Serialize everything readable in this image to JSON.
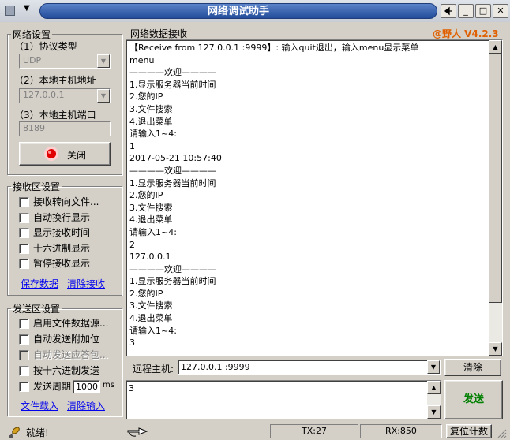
{
  "window": {
    "title": "网络调试助手",
    "version": "@野人 V4.2.3"
  },
  "titlebar": {
    "pin_icon": "pin-icon",
    "minimize": "_",
    "maximize": "□",
    "close": "✕"
  },
  "network": {
    "legend": "网络设置",
    "protocol_label": "（1）协议类型",
    "protocol_value": "UDP",
    "host_label": "（2）本地主机地址",
    "host_value": "127.0.0.1",
    "port_label": "（3）本地主机端口",
    "port_value": "8189",
    "close_button": "关闭"
  },
  "recv_settings": {
    "legend": "接收区设置",
    "options": [
      {
        "label": "接收转向文件...",
        "checked": false,
        "disabled": false
      },
      {
        "label": "自动换行显示",
        "checked": false,
        "disabled": false
      },
      {
        "label": "显示接收时间",
        "checked": false,
        "disabled": false
      },
      {
        "label": "十六进制显示",
        "checked": false,
        "disabled": false
      },
      {
        "label": "暂停接收显示",
        "checked": false,
        "disabled": false
      }
    ],
    "save_link": "保存数据",
    "clear_link": "清除接收"
  },
  "send_settings": {
    "legend": "发送区设置",
    "options": [
      {
        "label": "启用文件数据源...",
        "checked": false,
        "disabled": false
      },
      {
        "label": "自动发送附加位",
        "checked": false,
        "disabled": false
      },
      {
        "label": "自动发送应答包...",
        "checked": false,
        "disabled": true
      },
      {
        "label": "按十六进制发送",
        "checked": false,
        "disabled": false
      },
      {
        "label": "发送周期",
        "checked": false,
        "disabled": false
      }
    ],
    "period_value": "1000",
    "period_unit": "ms",
    "load_link": "文件载入",
    "clear_link": "清除输入"
  },
  "recv_area": {
    "label": "网络数据接收",
    "lines": [
      "【Receive from 127.0.0.1 :9999】: 输入quit退出，输入menu显示菜单",
      "menu",
      "————欢迎————",
      "1.显示服务器当前时间",
      "2.您的IP",
      "3.文件搜索",
      "4.退出菜单",
      "请输入1~4:",
      "1",
      "2017-05-21 10:57:40",
      "————欢迎————",
      "1.显示服务器当前时间",
      "2.您的IP",
      "3.文件搜索",
      "4.退出菜单",
      "请输入1~4:",
      "2",
      "127.0.0.1",
      "————欢迎————",
      "1.显示服务器当前时间",
      "2.您的IP",
      "3.文件搜索",
      "4.退出菜单",
      "请输入1~4:",
      "3"
    ]
  },
  "remote": {
    "label": "远程主机:",
    "value": "127.0.0.1 :9999",
    "clear_button": "清除"
  },
  "send_area": {
    "value": "3",
    "send_button": "发送"
  },
  "status": {
    "text": "就绪!",
    "tx": "TX:27",
    "rx": "RX:850",
    "reset_button": "复位计数"
  }
}
